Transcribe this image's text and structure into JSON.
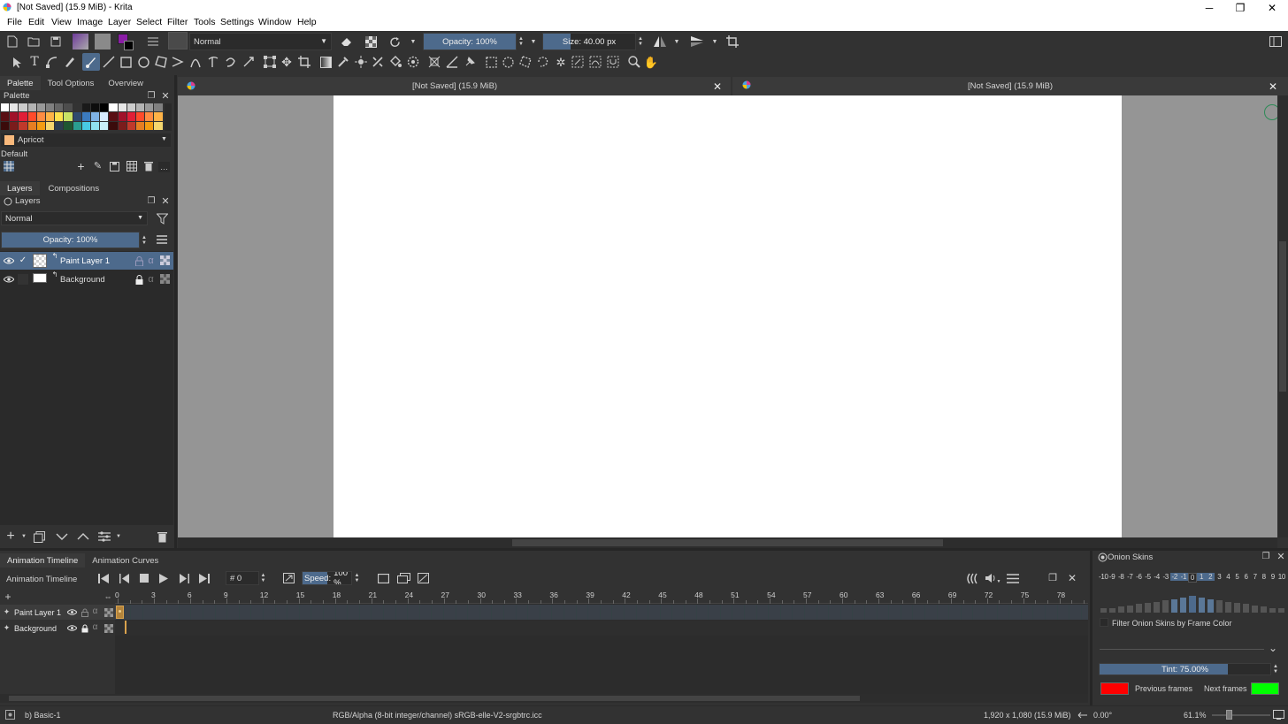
{
  "window": {
    "title": "[Not Saved]  (15.9 MiB)  - Krita"
  },
  "menu": [
    "File",
    "Edit",
    "View",
    "Image",
    "Layer",
    "Select",
    "Filter",
    "Tools",
    "Settings",
    "Window",
    "Help"
  ],
  "toolbar": {
    "blend_mode": "Normal",
    "opacity": "Opacity: 100%",
    "opacity_fraction": 1.0,
    "size": "Size: 40.00 px",
    "size_fraction": 0.3
  },
  "dock_tabs": {
    "palette": "Palette",
    "tool_options": "Tool Options",
    "overview": "Overview"
  },
  "palette": {
    "title": "Palette",
    "color_name": "Apricot",
    "color_hex": "#f9b97c",
    "set_name": "Default"
  },
  "layers_tabs": {
    "layers": "Layers",
    "compositions": "Compositions"
  },
  "layers": {
    "title": "Layers",
    "blend_mode": "Normal",
    "opacity": "Opacity:  100%",
    "opacity_fraction": 1.0,
    "items": [
      {
        "name": "Paint Layer 1",
        "selected": true
      },
      {
        "name": "Background",
        "selected": false
      }
    ]
  },
  "documents": [
    {
      "tab_title": "[Not Saved]  (15.9 MiB)"
    },
    {
      "tab_title": "[Not Saved]  (15.9 MiB)"
    }
  ],
  "bottom_tabs": {
    "timeline": "Animation Timeline",
    "curves": "Animation Curves"
  },
  "timeline": {
    "title": "Animation Timeline",
    "frame": "# 0",
    "speed_label": "Speed:",
    "speed_value": "100 %",
    "ruler": [
      "0",
      "3",
      "6",
      "9",
      "12",
      "15",
      "18",
      "21",
      "24",
      "27",
      "30",
      "33",
      "36",
      "39",
      "42",
      "45",
      "48",
      "51",
      "54",
      "57",
      "60",
      "63",
      "66",
      "69",
      "72",
      "75",
      "78"
    ],
    "layers": [
      "Paint Layer 1",
      "Background"
    ]
  },
  "onion": {
    "title": "Onion Skins",
    "numbers": [
      "-10",
      "-9",
      "-8",
      "-7",
      "-6",
      "-5",
      "-4",
      "-3",
      "-2",
      "-1",
      "0",
      "1",
      "2",
      "3",
      "4",
      "5",
      "6",
      "7",
      "8",
      "9",
      "10"
    ],
    "filter_label": "Filter Onion Skins by Frame Color",
    "tint": "Tint: 75.00%",
    "tint_fraction": 0.75,
    "previous_label": "Previous frames",
    "next_label": "Next frames",
    "previous_color": "#ff0000",
    "next_color": "#00ff00"
  },
  "status": {
    "brush": "b) Basic-1",
    "color_space": "RGB/Alpha (8-bit integer/channel)  sRGB-elle-V2-srgbtrc.icc",
    "dimensions": "1,920 x 1,080 (15.9 MiB)",
    "rotation": "0.00°",
    "zoom": "61.1%"
  }
}
